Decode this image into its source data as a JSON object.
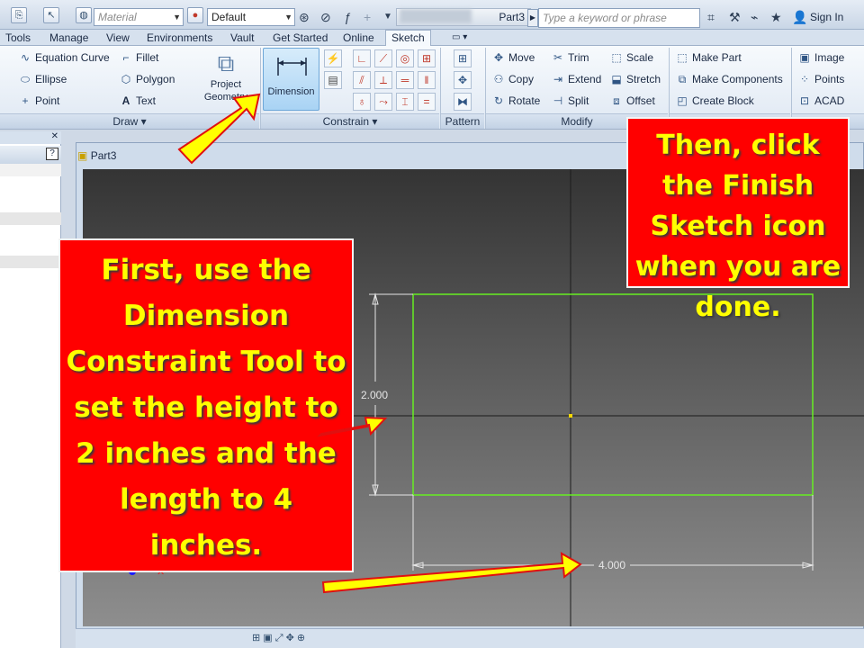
{
  "qat": {
    "material_placeholder": "Material",
    "appearance_value": "Default",
    "document_title": "Part3",
    "search_placeholder": "Type a keyword or phrase",
    "sign_in_label": "Sign In"
  },
  "tabs": [
    "Tools",
    "Manage",
    "View",
    "Environments",
    "Vault",
    "Get Started",
    "Online",
    "Sketch"
  ],
  "ribbon": {
    "draw": {
      "tools": [
        "Equation Curve",
        "Ellipse",
        "Point",
        "Fillet",
        "Polygon",
        "Text"
      ],
      "project_geometry_label_line1": "Project",
      "project_geometry_label_line2": "Geometry",
      "panel_label": "Draw"
    },
    "constrain": {
      "dimension_label": "Dimension",
      "panel_label": "Constrain"
    },
    "pattern": {
      "panel_label": "Pattern"
    },
    "modify": {
      "tools": [
        "Move",
        "Copy",
        "Rotate",
        "Trim",
        "Extend",
        "Split",
        "Scale",
        "Stretch",
        "Offset"
      ],
      "panel_label": "Modify"
    },
    "layout": {
      "tools": [
        "Make Part",
        "Make Components",
        "Create Block"
      ]
    },
    "insert": {
      "tools": [
        "Image",
        "Points",
        "ACAD"
      ]
    }
  },
  "document": {
    "tab_label": "Part3"
  },
  "sketch": {
    "height_dimension": "2.000",
    "length_dimension": "4.000"
  },
  "callouts": {
    "first": "First, use the Dimension Constraint Tool to set the height to 2 inches and the length to 4 inches.",
    "second": "Then, click the Finish Sketch icon when you are done."
  },
  "colors": {
    "callout_bg": "#ff0000",
    "callout_text": "#ffff00",
    "arrow_fill": "#ffff00",
    "sketch_rect": "#66ee22"
  }
}
